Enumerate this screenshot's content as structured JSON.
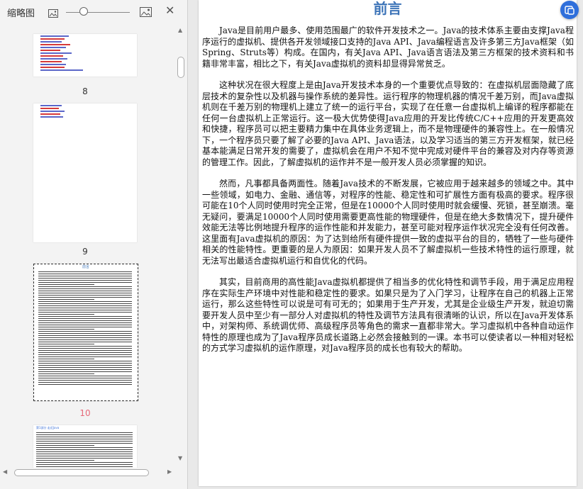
{
  "sidebar": {
    "title": "缩略图",
    "pages": [
      {
        "number": "8",
        "active": false
      },
      {
        "number": "9",
        "active": false
      },
      {
        "number": "10",
        "active": true
      },
      {
        "number": "",
        "active": false
      }
    ],
    "thumb10_title": "前言",
    "thumb11_title": "第1部分 走近Java"
  },
  "document": {
    "title": "前言",
    "paragraphs": [
      "Java是目前用户最多、使用范围最广的软件开发技术之一。Java的技术体系主要由支撑Java程序运行的虚拟机、提供各开发领域接口支持的Java API、Java编程语言及许多第三方Java框架（如Spring、Struts等）构成。在国内，有关Java API、Java语言语法及第三方框架的技术资料和书籍非常丰富，相比之下，有关Java虚拟机的资料却显得异常贫乏。",
      "这种状况在很大程度上是由Java开发技术本身的一个重要优点导致的：在虚拟机层面隐藏了底层技术的复杂性以及机器与操作系统的差异性。运行程序的物理机器的情况千差万别，而Java虚拟机则在千差万别的物理机上建立了统一的运行平台，实现了在任意一台虚拟机上编译的程序都能在任何一台虚拟机上正常运行。这一极大优势使得Java应用的开发比传统C/C++应用的开发更高效和快捷，程序员可以把主要精力集中在具体业务逻辑上，而不是物理硬件的兼容性上。在一般情况下，一个程序员只要了解了必要的Java API、Java语法，以及学习适当的第三方开发框架，就已经基本能满足日常开发的需要了，虚拟机会在用户不知不觉中完成对硬件平台的兼容及对内存等资源的管理工作。因此，了解虚拟机的运作并不是一般开发人员必须掌握的知识。",
      "然而，凡事都具备两面性。随着Java技术的不断发展，它被应用于越来越多的领域之中。其中一些领域，如电力、金融、通信等，对程序的性能、稳定性和可扩展性方面有极高的要求。程序很可能在10个人同时使用时完全正常，但是在10000个人同时使用时就会缓慢、死锁，甚至崩溃。毫无疑问，要满足10000个人同时使用需要更高性能的物理硬件，但是在绝大多数情况下，提升硬件效能无法等比例地提升程序的运作性能和并发能力，甚至可能对程序运作状况完全没有任何改善。这里面有Java虚拟机的原因：为了达到给所有硬件提供一致的虚拟平台的目的，牺牲了一些与硬件相关的性能特性。更重要的是人为原因：如果开发人员不了解虚拟机一些技术特性的运行原理，就无法写出最适合虚拟机运行和自优化的代码。",
      "其实，目前商用的高性能Java虚拟机都提供了相当多的优化特性和调节手段，用于满足应用程序在实际生产环境中对性能和稳定性的要求。如果只是为了入门学习，让程序在自己的机器上正常运行，那么这些特性可以说是可有可无的；如果用于生产开发，尤其是企业级生产开发，就迫切需要开发人员中至少有一部分人对虚拟机的特性及调节方法具有很清晰的认识，所以在Java开发体系中，对架构师、系统调优师、高级程序员等角色的需求一直都非常大。学习虚拟机中各种自动运作特性的原理也成为了Java程序员成长道路上必然会接触到的一课。本书可以使读者以一种相对轻松的方式学习虚拟机的运作原理，对Java程序员的成长也有较大的帮助。"
    ]
  },
  "colors": {
    "title_blue": "#3d74b8",
    "active_page": "#e66a7a",
    "float_button": "#2f6fdb"
  },
  "icons": [
    "image-small-icon",
    "image-large-icon",
    "close-icon",
    "float-tool-icon"
  ]
}
